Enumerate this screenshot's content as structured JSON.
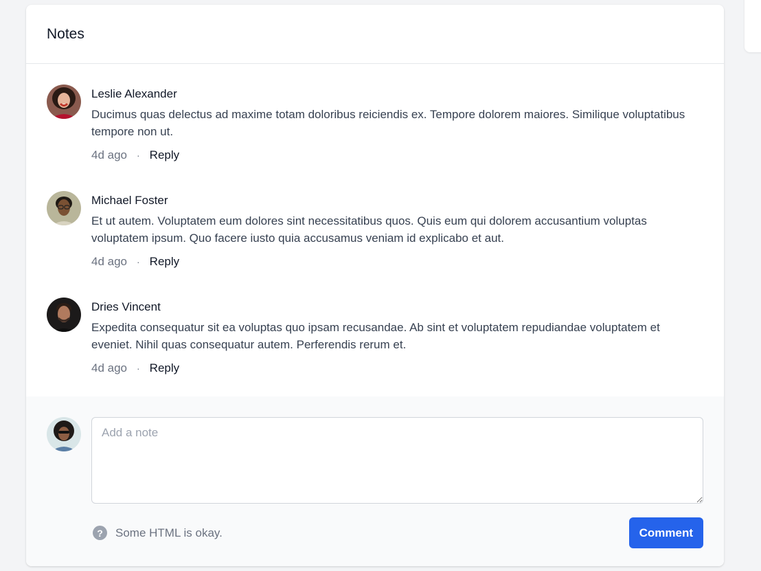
{
  "card": {
    "title": "Notes"
  },
  "comments": [
    {
      "author": "Leslie Alexander",
      "text": "Ducimus quas delectus ad maxime totam doloribus reiciendis ex. Tempore dolorem maiores. Similique voluptatibus tempore non ut.",
      "time": "4d ago",
      "reply": "Reply"
    },
    {
      "author": "Michael Foster",
      "text": "Et ut autem. Voluptatem eum dolores sint necessitatibus quos. Quis eum qui dolorem accusantium voluptas voluptatem ipsum. Quo facere iusto quia accusamus veniam id explicabo et aut.",
      "time": "4d ago",
      "reply": "Reply"
    },
    {
      "author": "Dries Vincent",
      "text": "Expedita consequatur sit ea voluptas quo ipsam recusandae. Ab sint et voluptatem repudiandae voluptatem et eveniet. Nihil quas consequatur autem. Perferendis rerum et.",
      "time": "4d ago",
      "reply": "Reply"
    }
  ],
  "compose": {
    "placeholder": "Add a note",
    "hint": "Some HTML is okay.",
    "help_icon": "?",
    "submit_label": "Comment"
  },
  "colors": {
    "accent": "#2563eb",
    "background": "#f3f4f6"
  }
}
